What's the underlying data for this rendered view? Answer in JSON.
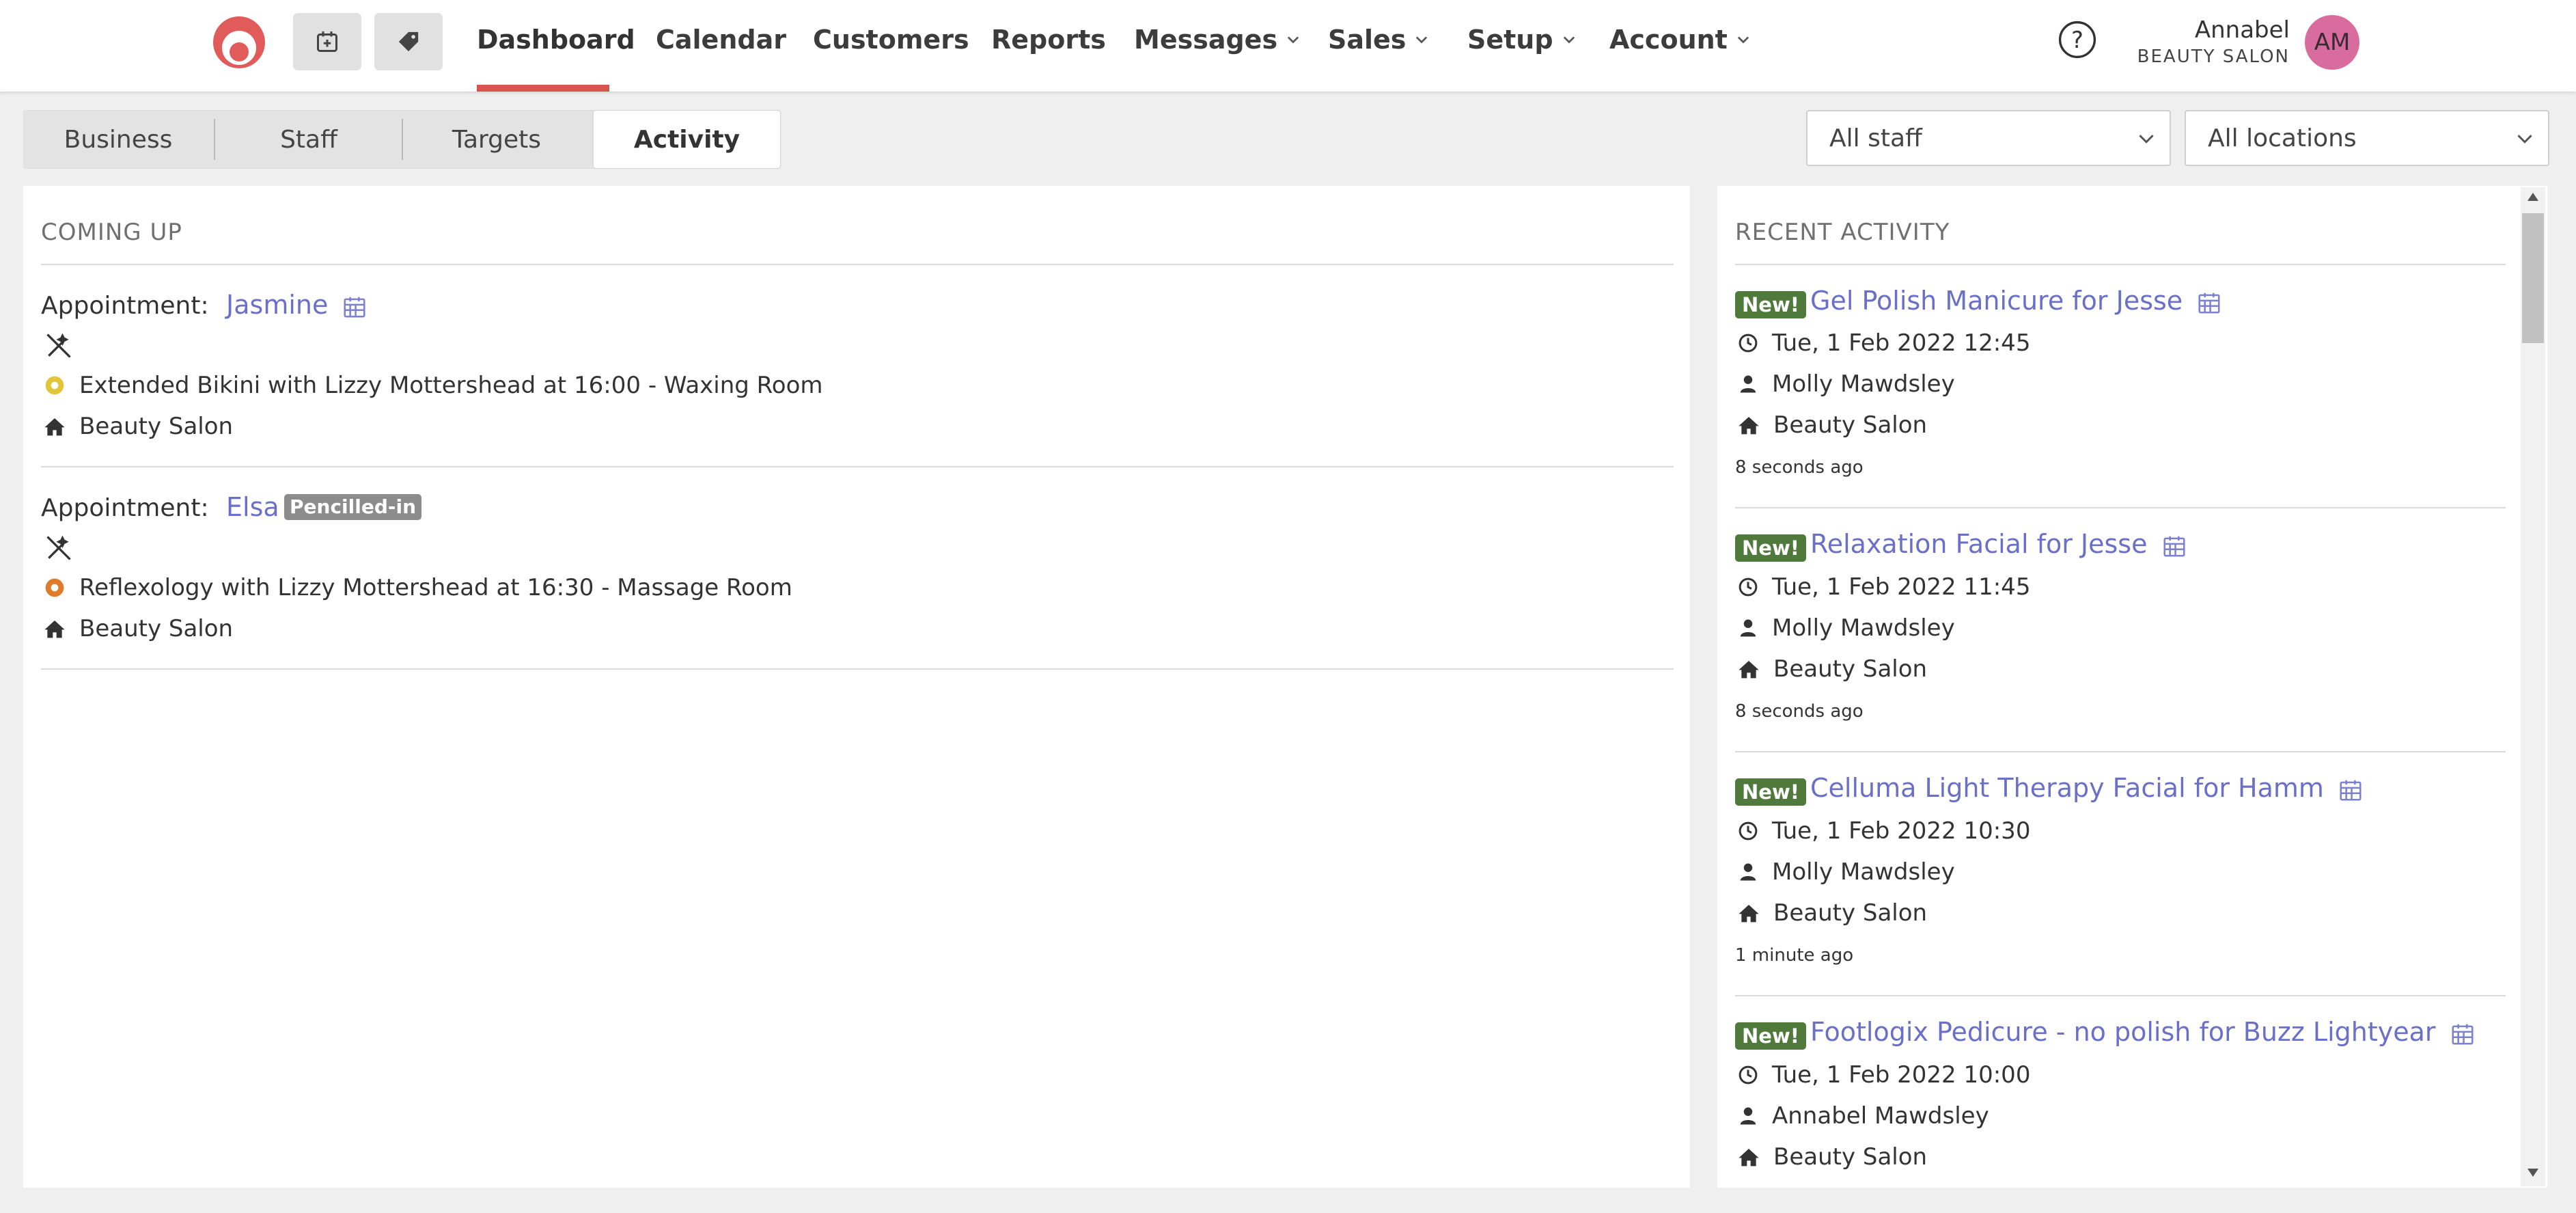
{
  "nav": {
    "items": [
      "Dashboard",
      "Calendar",
      "Customers",
      "Reports",
      "Messages",
      "Sales",
      "Setup",
      "Account"
    ],
    "active": "Dashboard"
  },
  "user": {
    "name": "Annabel",
    "org": "BEAUTY SALON",
    "initials": "AM"
  },
  "tabs": [
    "Business",
    "Staff",
    "Targets",
    "Activity"
  ],
  "filters": {
    "staff": "All staff",
    "locations": "All locations"
  },
  "coming_up": {
    "title": "COMING UP",
    "appointments": [
      {
        "label": "Appointment:",
        "customer": "Jasmine",
        "status_badge": "",
        "service": "Extended Bikini with Lizzy Mottershead at 16:00 - Waxing Room",
        "service_icon_color": "#e2c63a",
        "location": "Beauty Salon"
      },
      {
        "label": "Appointment:",
        "customer": "Elsa",
        "status_badge": "Pencilled-in",
        "service": "Reflexology with Lizzy Mottershead at 16:30 - Massage Room",
        "service_icon_color": "#e07b2a",
        "location": "Beauty Salon"
      }
    ]
  },
  "recent_activity": {
    "title": "RECENT ACTIVITY",
    "items": [
      {
        "badge": "New!",
        "title": "Gel Polish Manicure for Jesse",
        "datetime": "Tue, 1 Feb 2022 12:45",
        "staff": "Molly Mawdsley",
        "location": "Beauty Salon",
        "ago": "8 seconds ago"
      },
      {
        "badge": "New!",
        "title": "Relaxation Facial for Jesse",
        "datetime": "Tue, 1 Feb 2022 11:45",
        "staff": "Molly Mawdsley",
        "location": "Beauty Salon",
        "ago": "8 seconds ago"
      },
      {
        "badge": "New!",
        "title": "Celluma Light Therapy Facial for Hamm",
        "datetime": "Tue, 1 Feb 2022 10:30",
        "staff": "Molly Mawdsley",
        "location": "Beauty Salon",
        "ago": "1 minute ago"
      },
      {
        "badge": "New!",
        "title": "Footlogix Pedicure - no polish for Buzz Lightyear",
        "datetime": "Tue, 1 Feb 2022 10:00",
        "staff": "Annabel Mawdsley",
        "location": "Beauty Salon",
        "ago": ""
      }
    ]
  }
}
